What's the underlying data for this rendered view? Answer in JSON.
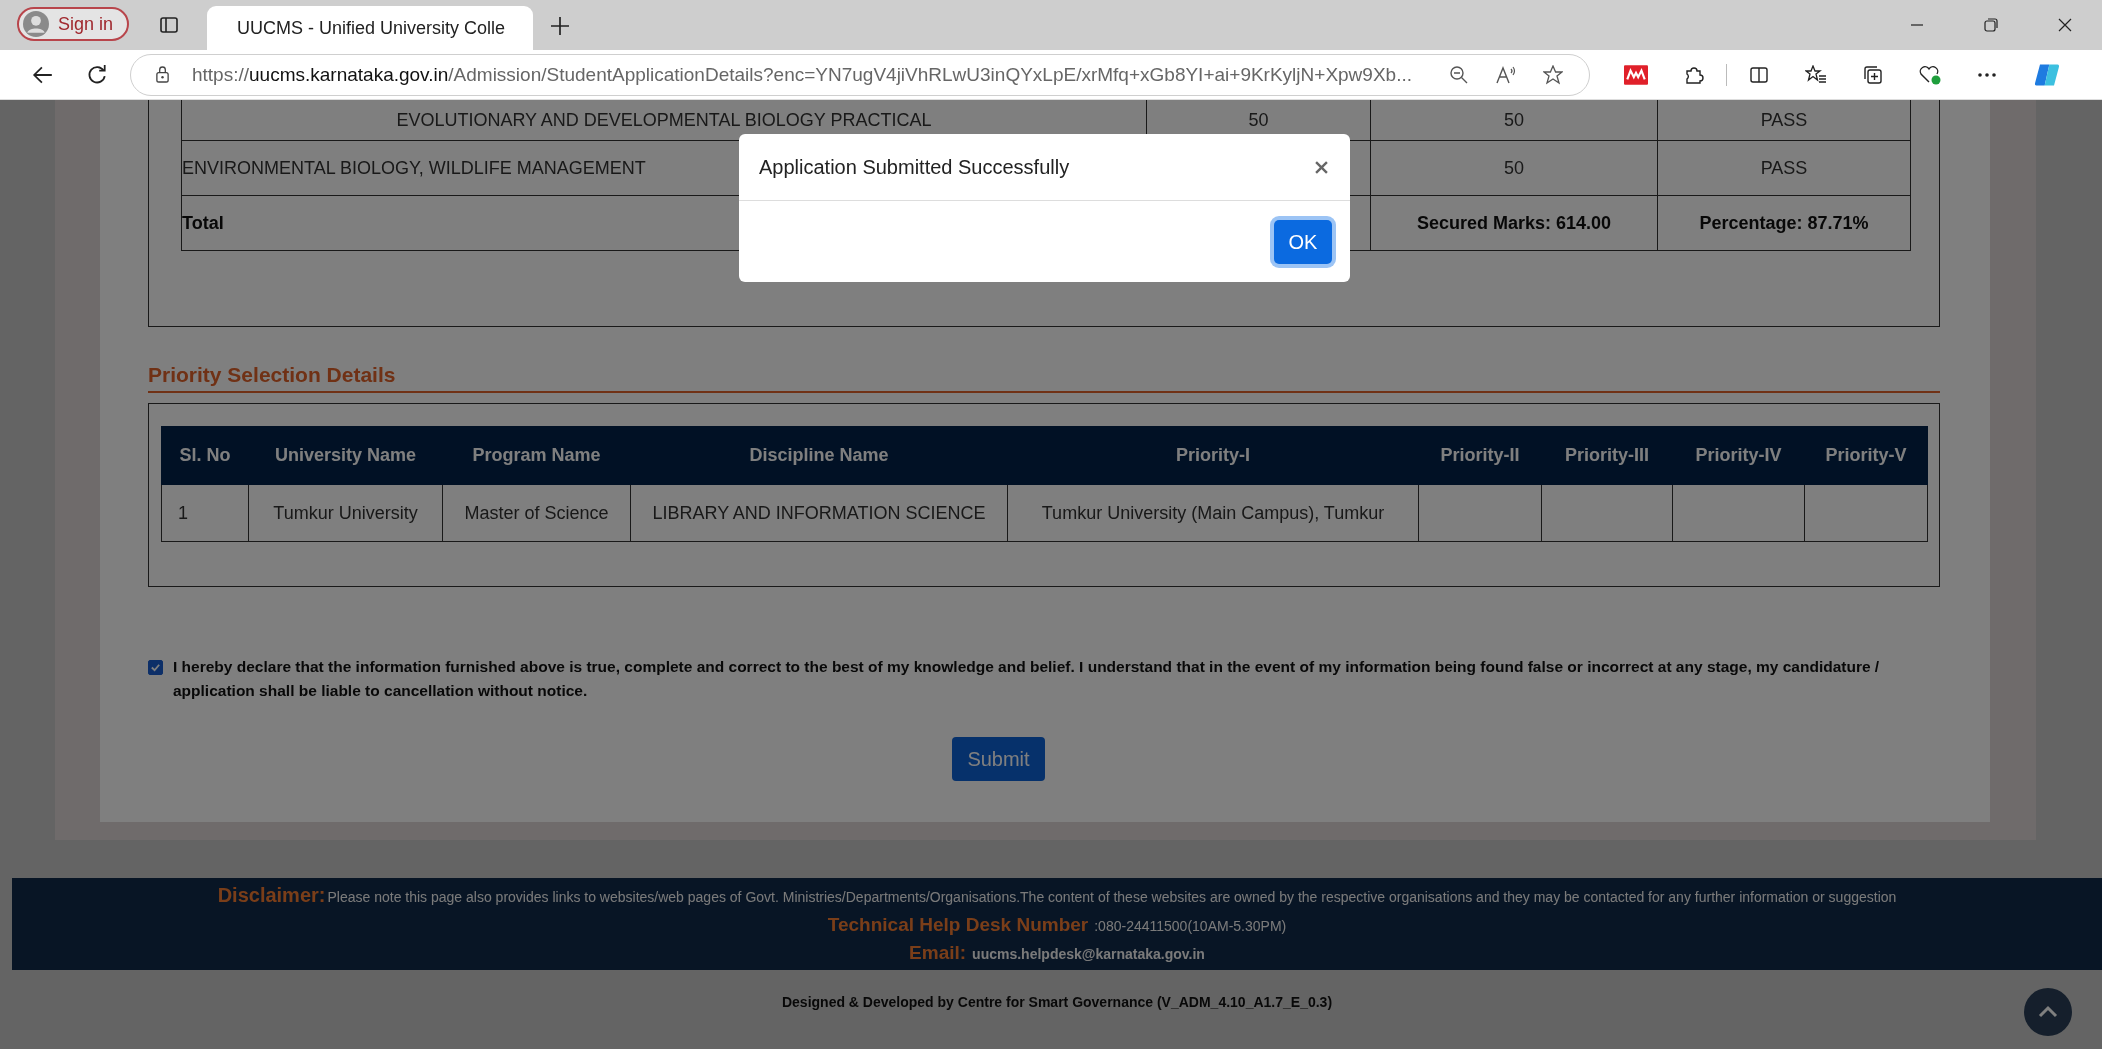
{
  "browser": {
    "profile_button": "Sign in",
    "tabs": [
      {
        "title": "UUCMS - Unified University Colle",
        "selected": true
      }
    ],
    "url": {
      "scheme": "https://",
      "host": "uucms.karnataka.gov.in",
      "path": "/Admission/StudentApplicationDetails?enc=YN7ugV4jiVhRLwU3inQYxLpE/xrMfq+xGb8YI+ai+9KrKyljN+Xpw9Xb..."
    }
  },
  "marks_table": {
    "rows": [
      {
        "subject": "EVOLUTIONARY AND DEVELOPMENTAL BIOLOGY PRACTICAL",
        "max": "50",
        "secured": "50",
        "result": "PASS"
      },
      {
        "subject": "ENVIRONMENTAL BIOLOGY, WILDLIFE MANAGEMENT",
        "secured": "50",
        "result": "PASS"
      }
    ],
    "total": {
      "label": "Total",
      "secured": "Secured Marks: 614.00",
      "percentage": "Percentage: 87.71%"
    }
  },
  "priority": {
    "heading": "Priority Selection Details",
    "columns": [
      "Sl. No",
      "University Name",
      "Program Name",
      "Discipline Name",
      "Priority-I",
      "Priority-II",
      "Priority-III",
      "Priority-IV",
      "Priority-V"
    ],
    "rows": [
      {
        "cells": [
          "1",
          "Tumkur University",
          "Master of Science",
          "LIBRARY AND INFORMATION SCIENCE",
          "Tumkur University (Main Campus), Tumkur"
        ]
      }
    ]
  },
  "declaration": {
    "checked": true,
    "text": "I hereby declare that the information furnished above is true, complete and correct to the best of my knowledge and belief. I understand that in the event of my information being found false or incorrect at any stage, my candidature / application shall be liable to cancellation without notice."
  },
  "submit_button": "Submit",
  "modal": {
    "title": "Application Submitted Successfully",
    "ok_button": "OK"
  },
  "footer": {
    "disclaimer_label": "Disclaimer:",
    "disclaimer_text": "Please note this page also provides links to websites/web pages of Govt. Ministries/Departments/Organisations.The content of these websites are owned by the respective organisations and they may be contacted for any further information or suggestion",
    "helpdesk_label": "Technical Help Desk Number",
    "helpdesk_value": ":080-24411500(10AM-5.30PM)",
    "email_label": "Email:",
    "email_value": "uucms.helpdesk@karnataka.gov.in",
    "credit": "Designed & Developed by Centre for Smart Governance (V_ADM_4.10_A1.7_E_0.3)"
  }
}
